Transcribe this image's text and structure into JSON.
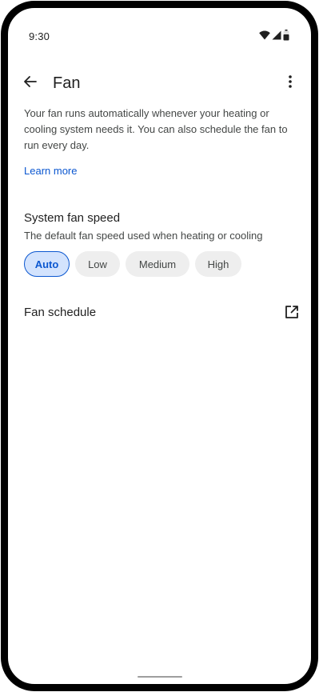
{
  "status_bar": {
    "time": "9:30",
    "icons": [
      "wifi-icon",
      "cellular-signal-icon",
      "battery-icon"
    ]
  },
  "app_bar": {
    "back_icon": "arrow-back-icon",
    "title": "Fan",
    "overflow_icon": "more-vert-icon"
  },
  "description": "Your fan runs automatically whenever your heating or cooling system needs it. You can also schedule the fan to run every day.",
  "learn_more": "Learn more",
  "system_fan_speed": {
    "title": "System fan speed",
    "subtitle": "The default fan speed used when heating or cooling",
    "options": [
      {
        "label": "Auto",
        "selected": true
      },
      {
        "label": "Low",
        "selected": false
      },
      {
        "label": "Medium",
        "selected": false
      },
      {
        "label": "High",
        "selected": false
      }
    ]
  },
  "fan_schedule": {
    "label": "Fan schedule",
    "icon": "open-in-new-icon"
  },
  "colors": {
    "accent": "#0b57d0",
    "selected_chip_bg": "#d3e3fd",
    "chip_bg": "#eeeeee",
    "text_primary": "#1f1f1f",
    "text_secondary": "#444746"
  }
}
